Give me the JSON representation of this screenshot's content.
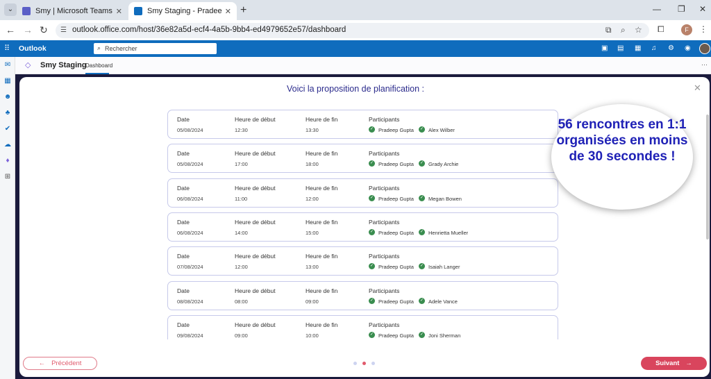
{
  "browser": {
    "tabs": [
      {
        "title": "Smy | Microsoft Teams",
        "active": false
      },
      {
        "title": "Smy Staging - Pradeep Gupta -",
        "active": true
      }
    ],
    "url": "outlook.office.com/host/36e82a5d-ecf4-4a5b-9bb4-ed4979652e57/dashboard",
    "profile_initial": "F"
  },
  "outlook": {
    "title": "Outlook",
    "search_placeholder": "Rechercher"
  },
  "app": {
    "name": "Smy Staging",
    "tab": "Dashboard"
  },
  "modal": {
    "title": "Voici la proposition de planification :",
    "labels": {
      "date": "Date",
      "start": "Heure de début",
      "end": "Heure de fin",
      "participants": "Participants"
    },
    "meetings": [
      {
        "date": "05/08/2024",
        "start": "12:30",
        "end": "13:30",
        "participants": [
          "Pradeep Gupta",
          "Alex Wilber"
        ]
      },
      {
        "date": "05/08/2024",
        "start": "17:00",
        "end": "18:00",
        "participants": [
          "Pradeep Gupta",
          "Grady Archie"
        ]
      },
      {
        "date": "06/08/2024",
        "start": "11:00",
        "end": "12:00",
        "participants": [
          "Pradeep Gupta",
          "Megan Bowen"
        ]
      },
      {
        "date": "06/08/2024",
        "start": "14:00",
        "end": "15:00",
        "participants": [
          "Pradeep Gupta",
          "Henrietta Mueller"
        ]
      },
      {
        "date": "07/08/2024",
        "start": "12:00",
        "end": "13:00",
        "participants": [
          "Pradeep Gupta",
          "Isaiah Langer"
        ]
      },
      {
        "date": "08/08/2024",
        "start": "08:00",
        "end": "09:00",
        "participants": [
          "Pradeep Gupta",
          "Adele Vance"
        ]
      },
      {
        "date": "09/08/2024",
        "start": "09:00",
        "end": "10:00",
        "participants": [
          "Pradeep Gupta",
          "Joni Sherman"
        ]
      }
    ],
    "callout": "56 rencontres en 1:1 organisées en moins de 30 secondes !",
    "prev_label": "Précédent",
    "next_label": "Suivant",
    "pagination": {
      "total": 3,
      "current": 2
    }
  },
  "colors": {
    "accent": "#d9455d",
    "outlook_blue": "#0f6cbd",
    "callout_text": "#1f21b6",
    "check": "#3a8d4f"
  }
}
